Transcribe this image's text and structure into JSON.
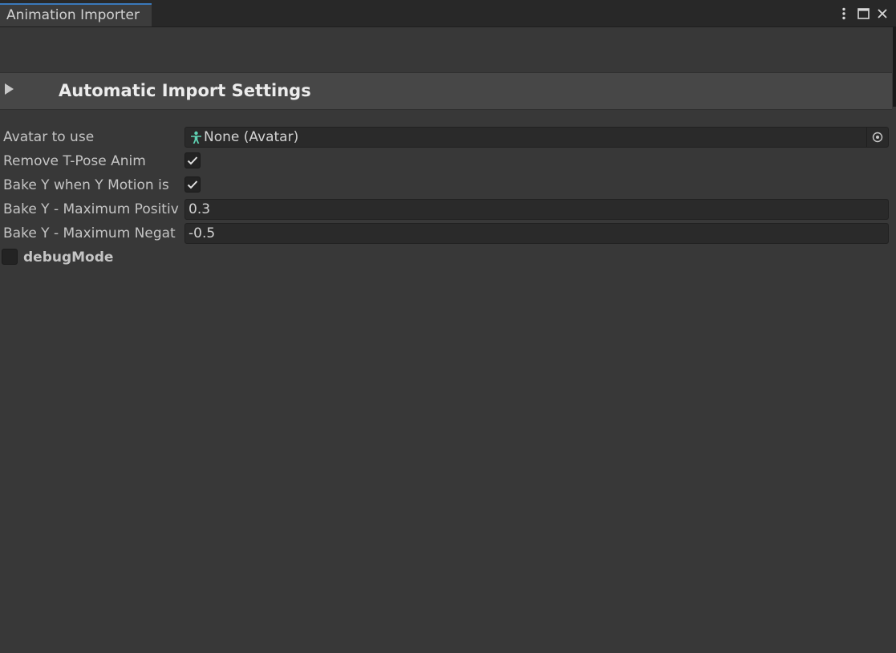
{
  "window": {
    "tab_title": "Animation Importer"
  },
  "foldout": {
    "title": "Automatic Import Settings",
    "expanded": false
  },
  "fields": {
    "avatar": {
      "label": "Avatar to use",
      "value": "None (Avatar)"
    },
    "remove_tpose": {
      "label": "Remove T-Pose Anim",
      "checked": true
    },
    "bake_y": {
      "label": "Bake Y when Y Motion is",
      "checked": true
    },
    "bake_y_max_pos": {
      "label": "Bake Y - Maximum Positiv",
      "value": "0.3"
    },
    "bake_y_max_neg": {
      "label": "Bake Y - Maximum Negat",
      "value": "-0.5"
    },
    "debug_mode": {
      "label": "debugMode",
      "checked": false
    }
  },
  "icons": {
    "menu": "kebab-menu-icon",
    "maximize": "maximize-icon",
    "close": "close-icon",
    "foldout": "triangle-right-icon",
    "avatar": "avatar-humanoid-icon",
    "picker": "object-picker-icon",
    "check": "checkmark-icon"
  },
  "colors": {
    "background": "#383838",
    "tab_accent": "#3a79bb",
    "avatar_icon": "#5fd3b4"
  }
}
